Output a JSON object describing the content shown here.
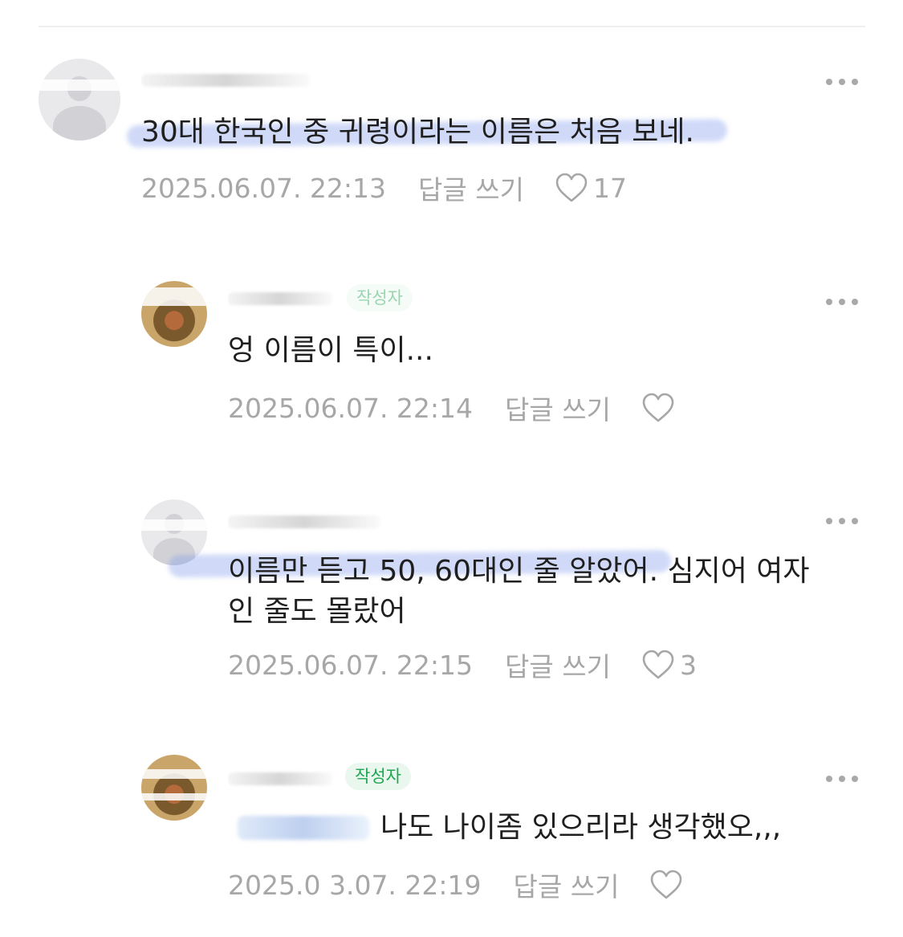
{
  "ui": {
    "reply_label": "답글 쓰기",
    "author_badge": "작성자",
    "colors": {
      "meta_gray": "#a7a7a7",
      "badge_green": "#20a550",
      "badge_bg": "#e9f7ee",
      "highlight_blue": "#7896eb"
    },
    "icons": {
      "more": "more-horizontal-icon",
      "like": "heart-outline-icon"
    }
  },
  "comments": [
    {
      "avatar": "default-profile-icon",
      "text": "30대 한국인 중 귀령이라는 이름은 처음 보네.",
      "date": "2025.06.07. 22:13",
      "likes": "17"
    },
    {
      "avatar": "monkey-avatar",
      "is_author": true,
      "text": "엉 이름이 특이...",
      "date": "2025.06.07. 22:14",
      "likes": ""
    },
    {
      "avatar": "default-profile-icon",
      "text_lines": [
        "이름만 듣고 50, 60대인 줄 알았어. 심지어 여자",
        "인 줄도 몰랐어"
      ],
      "date": "2025.06.07. 22:15",
      "likes": "3"
    },
    {
      "avatar": "monkey-avatar",
      "is_author": true,
      "text": "나도 나이좀 있으리라 생각했오,,,",
      "date": "2025.0 3.07. 22:19",
      "likes": ""
    }
  ]
}
